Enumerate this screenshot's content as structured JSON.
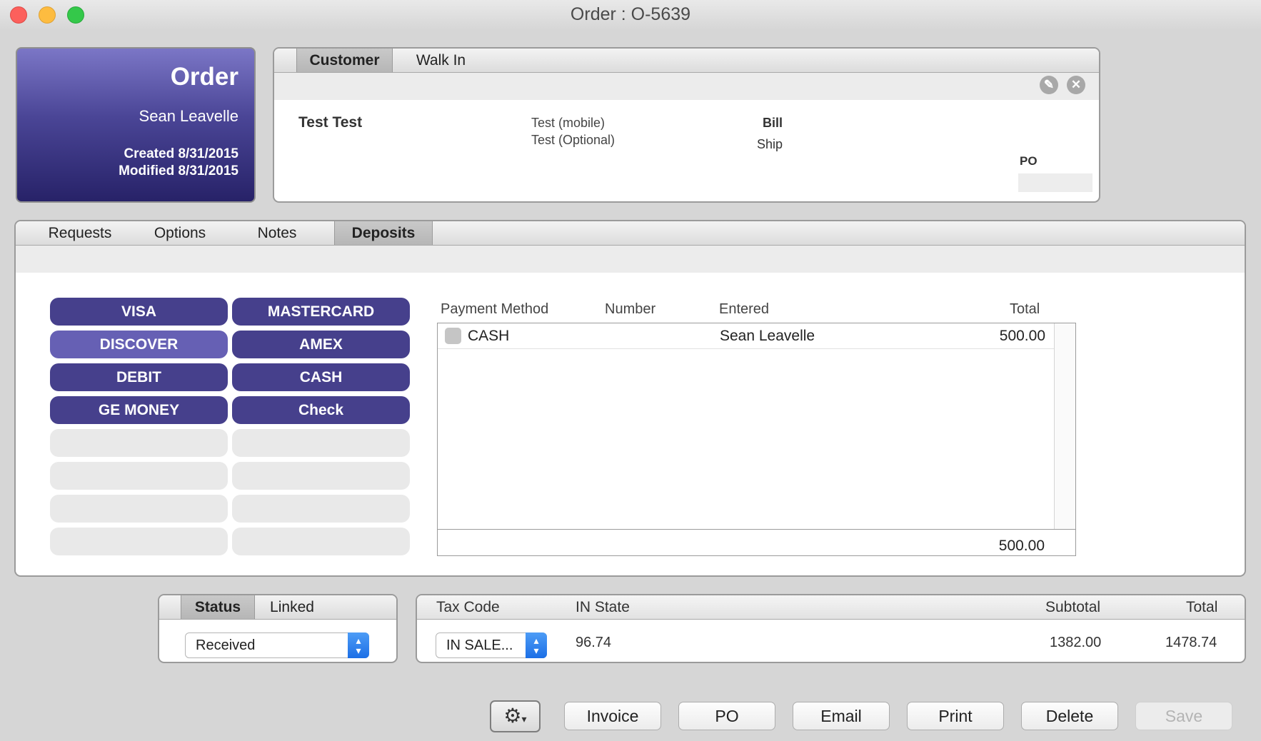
{
  "window": {
    "title": "Order : O-5639"
  },
  "order_card": {
    "title": "Order",
    "name": "Sean Leavelle",
    "created": "Created 8/31/2015",
    "modified": "Modified 8/31/2015"
  },
  "customer": {
    "tabs": [
      "Customer",
      "Walk In"
    ],
    "name": "Test Test",
    "phone_mobile": "Test (mobile)",
    "phone_optional": "Test (Optional)",
    "bill_label": "Bill",
    "ship_label": "Ship",
    "po_label": "PO"
  },
  "main_tabs": [
    "Requests",
    "Options",
    "Notes",
    "Deposits"
  ],
  "payment_buttons": [
    "VISA",
    "MASTERCARD",
    "DISCOVER",
    "AMEX",
    "DEBIT",
    "CASH",
    "GE MONEY",
    "Check"
  ],
  "deposits": {
    "columns": [
      "Payment Method",
      "Number",
      "Entered",
      "Total"
    ],
    "rows": [
      {
        "method": "CASH",
        "number": "",
        "entered": "Sean Leavelle",
        "total": "500.00"
      }
    ],
    "grand_total": "500.00"
  },
  "status": {
    "tabs": [
      "Status",
      "Linked"
    ],
    "selected": "Received"
  },
  "tax": {
    "headers": [
      "Tax Code",
      "IN State",
      "Subtotal",
      "Total"
    ],
    "tax_code": "IN SALE...",
    "in_state": "96.74",
    "subtotal": "1382.00",
    "total": "1478.74"
  },
  "actions": [
    "Invoice",
    "PO",
    "Email",
    "Print",
    "Delete",
    "Save"
  ]
}
